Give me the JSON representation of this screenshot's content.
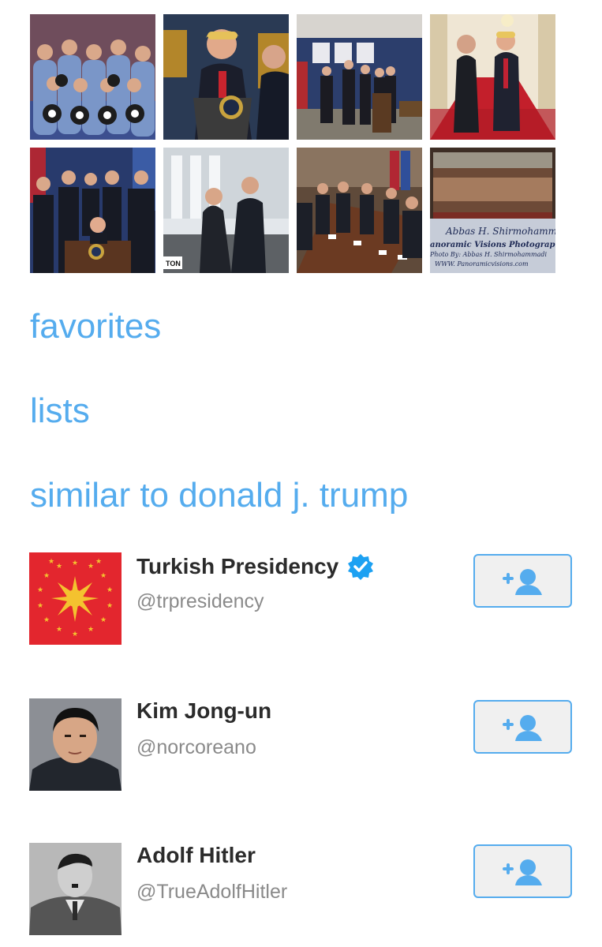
{
  "media_grid": {
    "photos": [
      {
        "icon": "astronaut-crew-photo"
      },
      {
        "icon": "podium-speech-photo"
      },
      {
        "icon": "ceremony-hall-photo"
      },
      {
        "icon": "red-carpet-hallway-photo"
      },
      {
        "icon": "signing-ceremony-photo"
      },
      {
        "icon": "outdoor-arrival-photo"
      },
      {
        "icon": "conference-table-photo"
      },
      {
        "icon": "panoramic-crowd-photo"
      }
    ],
    "watermark": {
      "line1": "Abbas H. Shirmohammadi",
      "line2": "anoramic Visions Photography",
      "line3": "Photo By: Abbas H. Shirmohammadi",
      "line4": "WWW. Panoramicvisions.com"
    },
    "caption_fragment": "TON"
  },
  "sections": {
    "favorites": "favorites",
    "lists": "lists",
    "similar": "similar to donald j. trump"
  },
  "accounts": [
    {
      "name": "Turkish Presidency",
      "handle": "@trpresidency",
      "verified": true,
      "avatar_icon": "turkish-presidency-seal-icon"
    },
    {
      "name": "Kim Jong-un",
      "handle": "@norcoreano",
      "verified": false,
      "avatar_icon": "portrait-avatar"
    },
    {
      "name": "Adolf Hitler",
      "handle": "@TrueAdolfHitler",
      "verified": false,
      "avatar_icon": "portrait-avatar"
    }
  ],
  "colors": {
    "accent": "#55acee",
    "button_bg": "#f0f0f0",
    "name_text": "#2b2b2b",
    "handle_text": "#8a8a8a",
    "seal_red": "#e3262e",
    "seal_gold": "#f4c22f"
  },
  "icons": {
    "follow": "add-user-icon",
    "verified": "verified-badge-icon"
  }
}
